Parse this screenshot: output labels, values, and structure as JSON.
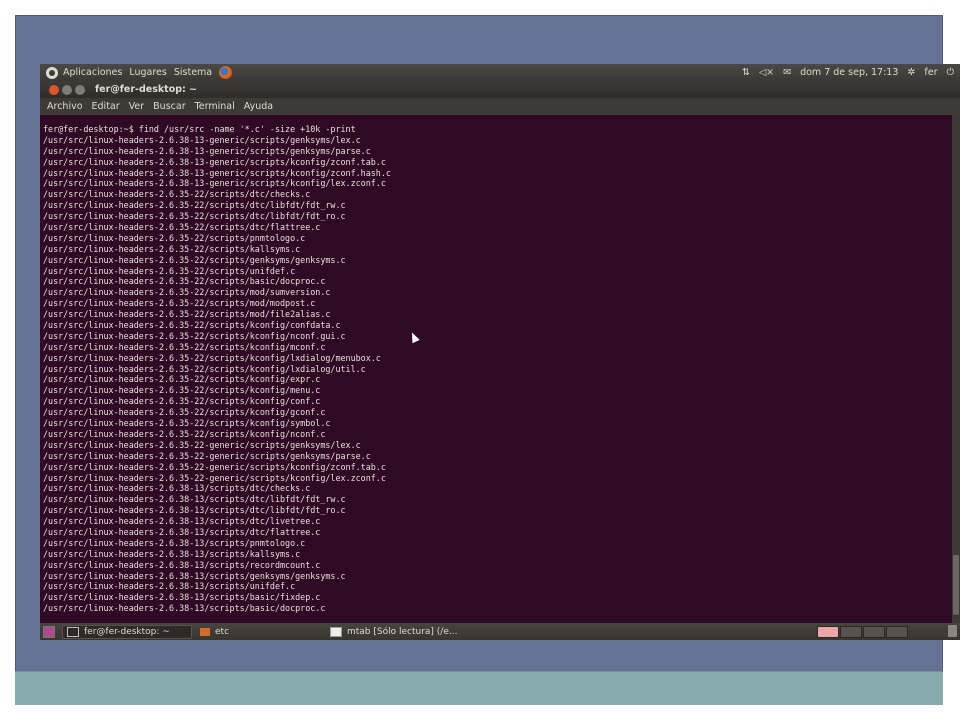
{
  "top_panel": {
    "menus": [
      "Aplicaciones",
      "Lugares",
      "Sistema"
    ],
    "clock": "dom  7 de sep, 17:13",
    "user": "fer"
  },
  "window": {
    "title": "fer@fer-desktop: ~",
    "menubar": [
      "Archivo",
      "Editar",
      "Ver",
      "Buscar",
      "Terminal",
      "Ayuda"
    ]
  },
  "terminal": {
    "lines": [
      "fer@fer-desktop:~$ find /usr/src -name '*.c' -size +10k -print",
      "/usr/src/linux-headers-2.6.38-13-generic/scripts/genksyms/lex.c",
      "/usr/src/linux-headers-2.6.38-13-generic/scripts/genksyms/parse.c",
      "/usr/src/linux-headers-2.6.38-13-generic/scripts/kconfig/zconf.tab.c",
      "/usr/src/linux-headers-2.6.38-13-generic/scripts/kconfig/zconf.hash.c",
      "/usr/src/linux-headers-2.6.38-13-generic/scripts/kconfig/lex.zconf.c",
      "/usr/src/linux-headers-2.6.35-22/scripts/dtc/checks.c",
      "/usr/src/linux-headers-2.6.35-22/scripts/dtc/libfdt/fdt_rw.c",
      "/usr/src/linux-headers-2.6.35-22/scripts/dtc/libfdt/fdt_ro.c",
      "/usr/src/linux-headers-2.6.35-22/scripts/dtc/flattree.c",
      "/usr/src/linux-headers-2.6.35-22/scripts/pnmtologo.c",
      "/usr/src/linux-headers-2.6.35-22/scripts/kallsyms.c",
      "/usr/src/linux-headers-2.6.35-22/scripts/genksyms/genksyms.c",
      "/usr/src/linux-headers-2.6.35-22/scripts/unifdef.c",
      "/usr/src/linux-headers-2.6.35-22/scripts/basic/docproc.c",
      "/usr/src/linux-headers-2.6.35-22/scripts/mod/sumversion.c",
      "/usr/src/linux-headers-2.6.35-22/scripts/mod/modpost.c",
      "/usr/src/linux-headers-2.6.35-22/scripts/mod/file2alias.c",
      "/usr/src/linux-headers-2.6.35-22/scripts/kconfig/confdata.c",
      "/usr/src/linux-headers-2.6.35-22/scripts/kconfig/nconf.gui.c",
      "/usr/src/linux-headers-2.6.35-22/scripts/kconfig/mconf.c",
      "/usr/src/linux-headers-2.6.35-22/scripts/kconfig/lxdialog/menubox.c",
      "/usr/src/linux-headers-2.6.35-22/scripts/kconfig/lxdialog/util.c",
      "/usr/src/linux-headers-2.6.35-22/scripts/kconfig/expr.c",
      "/usr/src/linux-headers-2.6.35-22/scripts/kconfig/menu.c",
      "/usr/src/linux-headers-2.6.35-22/scripts/kconfig/conf.c",
      "/usr/src/linux-headers-2.6.35-22/scripts/kconfig/gconf.c",
      "/usr/src/linux-headers-2.6.35-22/scripts/kconfig/symbol.c",
      "/usr/src/linux-headers-2.6.35-22/scripts/kconfig/nconf.c",
      "/usr/src/linux-headers-2.6.35-22-generic/scripts/genksyms/lex.c",
      "/usr/src/linux-headers-2.6.35-22-generic/scripts/genksyms/parse.c",
      "/usr/src/linux-headers-2.6.35-22-generic/scripts/kconfig/zconf.tab.c",
      "/usr/src/linux-headers-2.6.35-22-generic/scripts/kconfig/lex.zconf.c",
      "/usr/src/linux-headers-2.6.38-13/scripts/dtc/checks.c",
      "/usr/src/linux-headers-2.6.38-13/scripts/dtc/libfdt/fdt_rw.c",
      "/usr/src/linux-headers-2.6.38-13/scripts/dtc/libfdt/fdt_ro.c",
      "/usr/src/linux-headers-2.6.38-13/scripts/dtc/livetree.c",
      "/usr/src/linux-headers-2.6.38-13/scripts/dtc/flattree.c",
      "/usr/src/linux-headers-2.6.38-13/scripts/pnmtologo.c",
      "/usr/src/linux-headers-2.6.38-13/scripts/kallsyms.c",
      "/usr/src/linux-headers-2.6.38-13/scripts/recordmcount.c",
      "/usr/src/linux-headers-2.6.38-13/scripts/genksyms/genksyms.c",
      "/usr/src/linux-headers-2.6.38-13/scripts/unifdef.c",
      "/usr/src/linux-headers-2.6.38-13/scripts/basic/fixdep.c",
      "/usr/src/linux-headers-2.6.38-13/scripts/basic/docproc.c"
    ]
  },
  "taskbar": {
    "tasks": [
      "fer@fer-desktop: ~",
      "etc",
      "mtab [Sólo lectura] (/e..."
    ]
  }
}
